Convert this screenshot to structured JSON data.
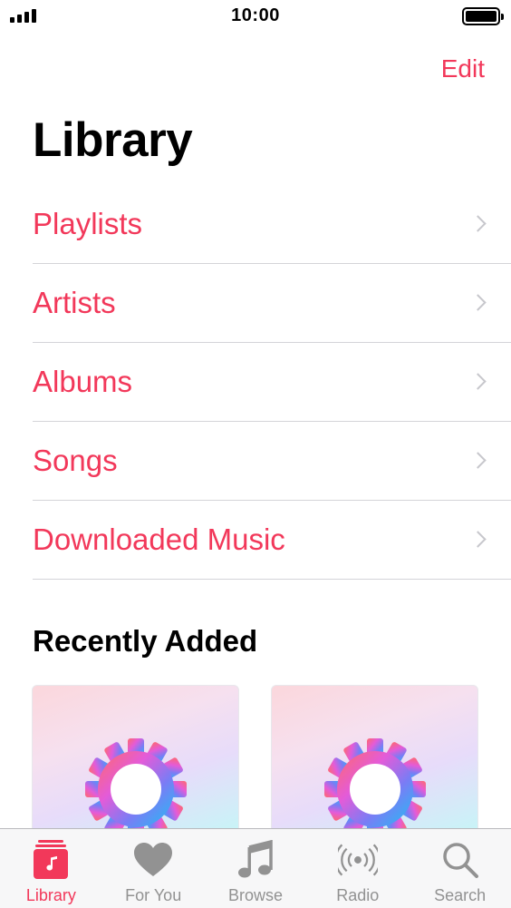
{
  "status_bar": {
    "time": "10:00"
  },
  "nav": {
    "edit_label": "Edit",
    "title": "Library"
  },
  "library_items": [
    {
      "label": "Playlists"
    },
    {
      "label": "Artists"
    },
    {
      "label": "Albums"
    },
    {
      "label": "Songs"
    },
    {
      "label": "Downloaded Music"
    }
  ],
  "recently_added": {
    "title": "Recently Added",
    "albums": [
      {
        "icon": "gear-icon"
      },
      {
        "icon": "gear-icon"
      }
    ]
  },
  "tab_bar": {
    "tabs": [
      {
        "label": "Library",
        "icon": "library-icon",
        "active": true
      },
      {
        "label": "For You",
        "icon": "heart-icon",
        "active": false
      },
      {
        "label": "Browse",
        "icon": "music-note-icon",
        "active": false
      },
      {
        "label": "Radio",
        "icon": "radio-icon",
        "active": false
      },
      {
        "label": "Search",
        "icon": "search-icon",
        "active": false
      }
    ]
  },
  "colors": {
    "accent": "#f2385a",
    "inactive": "#929292",
    "separator": "#d4d4d8"
  }
}
